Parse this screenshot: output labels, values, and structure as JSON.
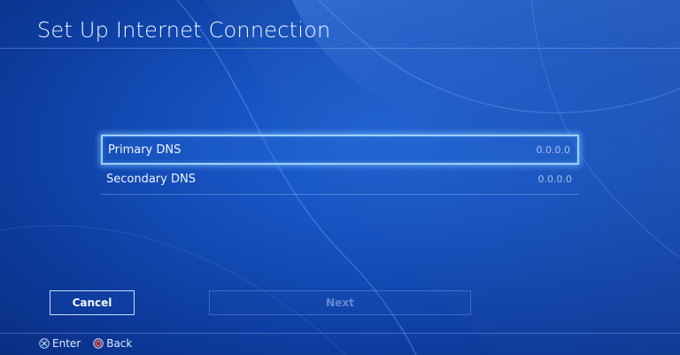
{
  "header": {
    "title": "Set Up Internet Connection"
  },
  "dns_list": [
    {
      "label": "Primary DNS",
      "value": "0.0.0.0",
      "focused": true
    },
    {
      "label": "Secondary DNS",
      "value": "0.0.0.0",
      "focused": false
    }
  ],
  "buttons": {
    "cancel_label": "Cancel",
    "next_label": "Next",
    "next_enabled": false
  },
  "footer": {
    "enter_label": "Enter",
    "enter_icon": "cross-button-icon",
    "back_label": "Back",
    "back_icon": "circle-button-icon"
  },
  "colors": {
    "background": "#1550bd",
    "focus_outline": "#9fd0ff",
    "text": "#eef4ff"
  }
}
